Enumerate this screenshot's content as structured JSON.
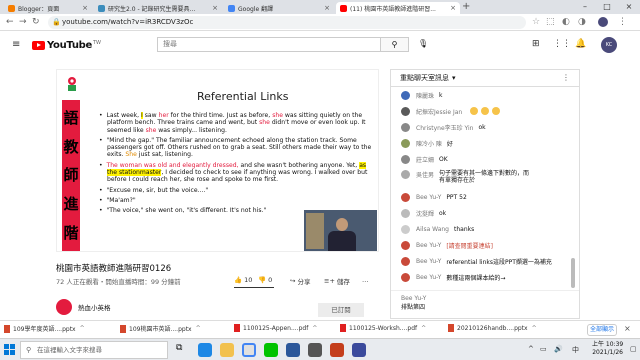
{
  "tabs": [
    {
      "title": "Blogger：頁面",
      "color": "#f57d00"
    },
    {
      "title": "研究生2.0 - 記錄研究生需要具...",
      "color": "#3c8dbc"
    },
    {
      "title": "Google 翻譯",
      "color": "#4285f4"
    },
    {
      "title": "(11) 桃園市英語教師進階研習...",
      "color": "#ff0000",
      "active": true
    }
  ],
  "address": {
    "url": "youtube.com/watch?v=iR3RCDV3zOc"
  },
  "header": {
    "logo_text": "YouTube",
    "logo_sup": "TW",
    "search_placeholder": "搜尋",
    "search_icon": "search-icon",
    "mic_icon": "mic-icon",
    "create_icon": "video-add-icon",
    "apps_icon": "apps-grid-icon",
    "bell_icon": "bell-icon",
    "avatar_text": "KC"
  },
  "slide": {
    "title": "Referential Links",
    "side_chars": [
      "語",
      "教",
      "師",
      "進",
      "階"
    ],
    "p1_a": "Last week, ",
    "p1_i": "I",
    "p1_b": " saw ",
    "p1_her": "her",
    "p1_c": " for the third time. Just as before, ",
    "p1_she1": "she",
    "p1_d": " was sitting quietly on the platform bench. Three trains came and went, but ",
    "p1_she2": "she",
    "p1_e": " didn't move or even look up. It seemed like ",
    "p1_she3": "she",
    "p1_f": " was simply... listening.",
    "p2_a": "\"Mind the gap.\" The familiar announcement echoed along the station track.  Some passengers got off. Others rushed on to grab a seat. Still others made their way to the exits. ",
    "p2_she": "She",
    "p2_b": " just sat, listening.",
    "p3_a": "The woman was old and elegantly dressed,",
    "p3_b": " and she wasn't bothering anyone. Yet, ",
    "p3_hl": "as the stationmaster",
    "p3_c": ", I decided to check to see if anything was wrong. I walked over but before I could reach her, she rose and spoke to me first.",
    "p4": "\"Excuse me, sir, but the voice....\"",
    "p5": "\"Ma'am?\"",
    "p6": "\"The voice,\" she went on, \"it's different. It's not his.\""
  },
  "video": {
    "title": "桃園市英語教師進階研習0126",
    "meta": "72 人正在觀看・開始直播時間：99 分鐘前",
    "likes": "10",
    "like_ratio": 1.0,
    "dislikes": "0",
    "share": "分享",
    "save": "儲存",
    "more": "…",
    "channel": "熱血小英格",
    "subscribed": "已訂閱"
  },
  "chat": {
    "header": "重點聊天室訊息",
    "messages": [
      {
        "author": "陳麗珠",
        "text": "k",
        "color": "#3f6ab8"
      },
      {
        "author": "紀振宏Jessie Jan",
        "text": "",
        "color": "#5a5a5a",
        "emoji": true
      },
      {
        "author": "Christyne李玉珍 Yin",
        "text": "ok",
        "color": "#888"
      },
      {
        "author": "陳冷小 陳",
        "text": "好",
        "color": "#8a9a5a"
      },
      {
        "author": "莊立姍",
        "text": "OK",
        "color": "#888"
      },
      {
        "author": "吳佳男",
        "text": "句子需要有其一條邊下對數的，而有單獨存在於",
        "color": "#aaa",
        "tall": true
      },
      {
        "author": "Bee Yu-Y",
        "text": "PPT 52",
        "color": "#c94a3a"
      },
      {
        "author": "沈挺輝",
        "text": "ok",
        "color": "#bbb"
      },
      {
        "author": "Ailsa Wang",
        "text": "thanks",
        "color": "#ccc"
      },
      {
        "author": "Bee Yu-Y",
        "text": "[請查閱重要連結]",
        "color": "#c94a3a",
        "red": true
      },
      {
        "author": "Bee Yu-Y",
        "text": "referential links這段PPT擷選一為補充",
        "color": "#c94a3a"
      },
      {
        "author": "Bee Yu-Y",
        "text": "數種這兩個課本給的→",
        "color": "#c94a3a"
      }
    ],
    "footer_author": "Bee Yu-Y",
    "footer_text": "排點第四"
  },
  "downloads": [
    {
      "name": "109學年度英語....pptx",
      "kind": "ppt"
    },
    {
      "name": "109桃園市英語....pptx",
      "kind": "ppt"
    },
    {
      "name": "1100125-Appen....pdf",
      "kind": "pdf"
    },
    {
      "name": "1100125-Worksh....pdf",
      "kind": "pdf"
    },
    {
      "name": "20210126handb....pptx",
      "kind": "ppt"
    }
  ],
  "downloads_show_all": "全部顯示",
  "taskbar": {
    "search_placeholder": "在這裡輸入文字來搜尋",
    "lang": "中",
    "time": "上午 10:39",
    "date": "2021/1/26"
  }
}
